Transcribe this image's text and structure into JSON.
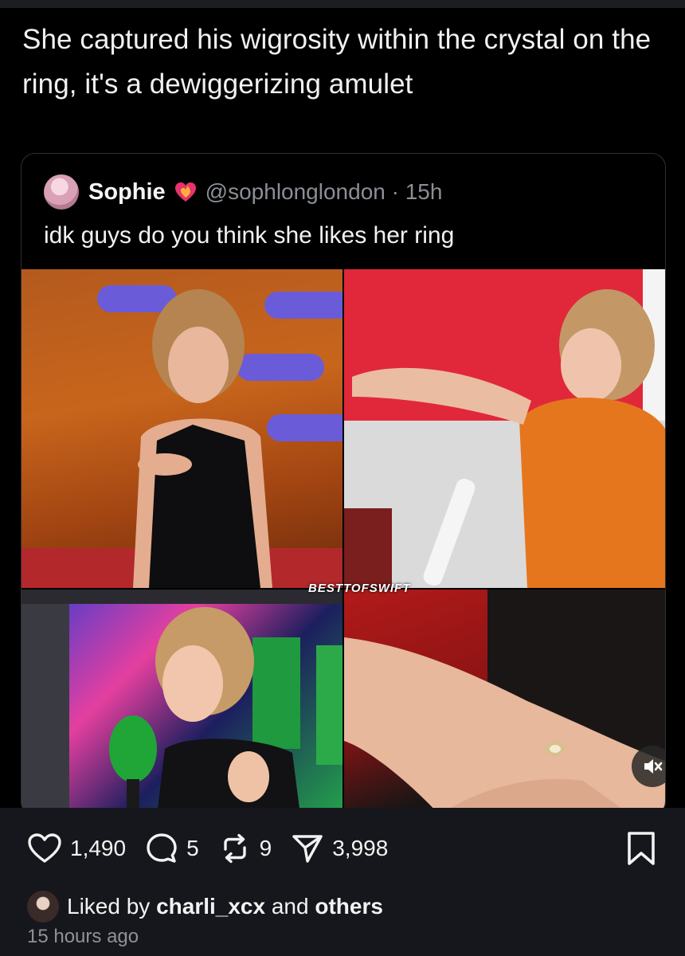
{
  "post": {
    "text": "She captured his wigrosity within the crystal on the ring, it's a dewiggerizing amulet"
  },
  "quote": {
    "author_name": "Sophie",
    "handle_time": "@sophlonglondon · 15h",
    "text": "idk guys do you think she likes her ring",
    "watermark": "BESTTOFSWIFT",
    "badge_icon": "heart-fire-icon"
  },
  "actions": {
    "likes": "1,490",
    "replies": "5",
    "reposts": "9",
    "shares": "3,998"
  },
  "liked_by": {
    "prefix": "Liked by",
    "user": "charli_xcx",
    "middle": "and",
    "suffix": "others"
  },
  "timestamp": "15 hours ago",
  "colors": {
    "background": "#000000",
    "bar": "#16171c",
    "muted_text": "#8e9297"
  }
}
